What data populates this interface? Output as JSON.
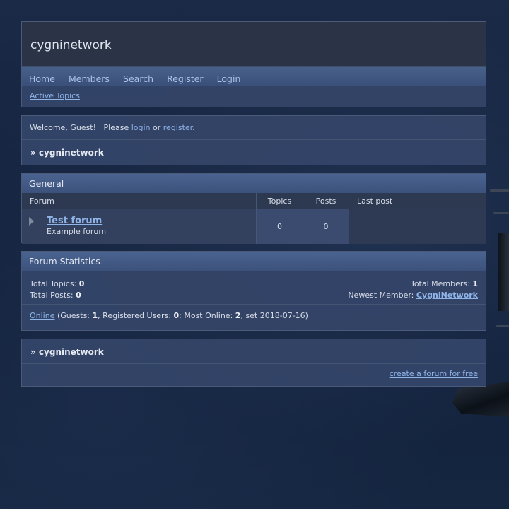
{
  "header": {
    "site_name": "cygninetwork",
    "nav": [
      "Home",
      "Members",
      "Search",
      "Register",
      "Login"
    ],
    "active_topics": "Active Topics"
  },
  "welcome": {
    "greeting": "Welcome, Guest!   Please ",
    "login": "login",
    "or": " or ",
    "register": "register",
    "period": ".",
    "crumb": "» cygninetwork"
  },
  "general": {
    "category": "General",
    "columns": {
      "forum": "Forum",
      "topics": "Topics",
      "posts": "Posts",
      "last_post": "Last post"
    },
    "forums": [
      {
        "name": "Test forum",
        "description": "Example forum",
        "topics": "0",
        "posts": "0",
        "last_post": ""
      }
    ]
  },
  "stats": {
    "title": "Forum Statistics",
    "total_topics_label": "Total Topics: ",
    "total_topics": "0",
    "total_posts_label": "Total Posts: ",
    "total_posts": "0",
    "total_members_label": "Total Members: ",
    "total_members": "1",
    "newest_member_label": "Newest Member: ",
    "newest_member": "CygniNetwork",
    "online_link": "Online",
    "online_guests_label": " (Guests: ",
    "guests": "1",
    "registered_label": ", Registered Users: ",
    "registered": "0",
    "most_online_label": "; Most Online: ",
    "most_online": "2",
    "set_date": ", set 2018-07-16)"
  },
  "footer": {
    "crumb": "» cygninetwork",
    "credit": "create a forum for free"
  }
}
